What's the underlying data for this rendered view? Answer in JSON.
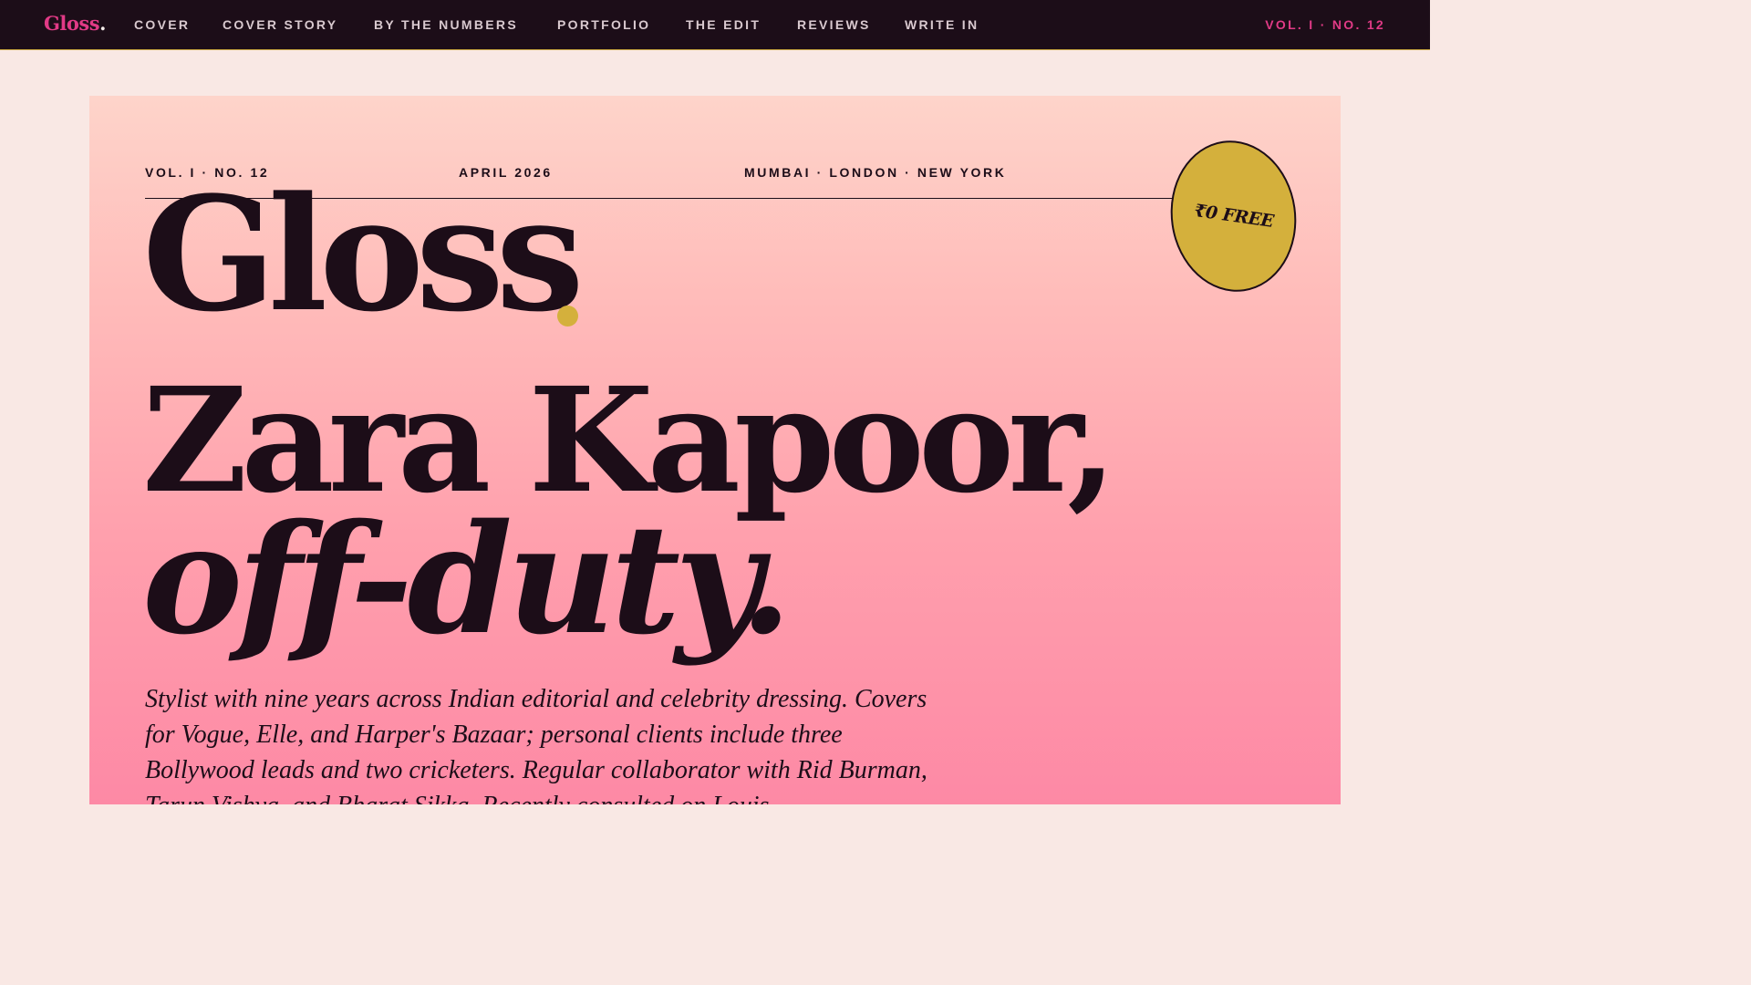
{
  "nav": {
    "brand": "Gloss",
    "brand_dot": ".",
    "links": [
      "COVER",
      "COVER STORY",
      "BY THE NUMBERS",
      "PORTFOLIO",
      "THE EDIT",
      "REVIEWS",
      "WRITE IN"
    ],
    "issue": "VOL. I · NO. 12"
  },
  "cover": {
    "meta": {
      "issue": "VOL. I · NO. 12",
      "date": "APRIL 2026",
      "cities": "MUMBAI · LONDON · NEW YORK"
    },
    "masthead": "Gloss",
    "price_badge": "₹0 FREE",
    "headline": "Zara Kapoor,",
    "headline_italic": "off-duty.",
    "deck": "Stylist with nine years across Indian editorial and celebrity dressing. Covers for Vogue, Elle, and Harper's Bazaar; personal clients include three Bollywood leads and two cricketers. Regular collaborator with Rid Burman, Tarun Vishva, and Bharat Sikka. Recently consulted on Louis"
  },
  "colors": {
    "nav_bg": "#1c0d18",
    "brand_pink": "#e13a86",
    "gold": "#d4b03c",
    "ink": "#1c0d18",
    "page_bg": "#f9e8e4",
    "cover_gradient_top": "#fed4ca",
    "cover_gradient_bottom": "#fd89a5"
  }
}
